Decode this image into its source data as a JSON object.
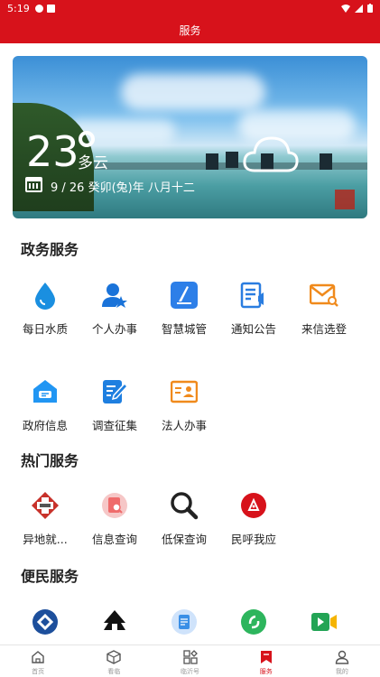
{
  "status": {
    "time": "5:19"
  },
  "header": {
    "title": "服务"
  },
  "weather": {
    "temperature": "23",
    "condition": "多云",
    "date": "9 / 26  癸卯(兔)年 八月十二"
  },
  "sections": {
    "gov": {
      "title": "政务服务",
      "items": [
        {
          "label": "每日水质",
          "icon": "water-drop-icon",
          "color": "#1a8fe0"
        },
        {
          "label": "个人办事",
          "icon": "person-star-icon",
          "color": "#1a73d9"
        },
        {
          "label": "智慧城管",
          "icon": "smart-city-icon",
          "color": "#2d7fe8"
        },
        {
          "label": "通知公告",
          "icon": "notice-icon",
          "color": "#2a7de0"
        },
        {
          "label": "来信选登",
          "icon": "mail-search-icon",
          "color": "#f08a1c"
        },
        {
          "label": "政府信息",
          "icon": "gov-info-icon",
          "color": "#2196f3"
        },
        {
          "label": "调查征集",
          "icon": "survey-edit-icon",
          "color": "#1e7fe0"
        },
        {
          "label": "法人办事",
          "icon": "id-card-icon",
          "color": "#f08a1c"
        }
      ]
    },
    "hot": {
      "title": "热门服务",
      "items": [
        {
          "label": "异地就...",
          "icon": "medical-cross-icon",
          "color": "#c8322b"
        },
        {
          "label": "信息查询",
          "icon": "info-query-icon",
          "color": "#ef6b6b"
        },
        {
          "label": "低保查询",
          "icon": "magnifier-icon",
          "color": "#222222"
        },
        {
          "label": "民呼我应",
          "icon": "citizen-call-icon",
          "color": "#d7121b"
        }
      ]
    },
    "people": {
      "title": "便民服务",
      "items": [
        {
          "label": "",
          "icon": "bank-logo-icon",
          "color": "#1d4f9c"
        },
        {
          "label": "",
          "icon": "house-tree-icon",
          "color": "#111111"
        },
        {
          "label": "",
          "icon": "document-icon",
          "color": "#3a8fe6"
        },
        {
          "label": "",
          "icon": "green-circle-icon",
          "color": "#2db55d"
        },
        {
          "label": "",
          "icon": "video-play-icon",
          "color": "#23a455"
        }
      ]
    }
  },
  "tabs": [
    {
      "label": "首页",
      "icon": "home-icon",
      "active": false
    },
    {
      "label": "看临",
      "icon": "cube-icon",
      "active": false
    },
    {
      "label": "临沂号",
      "icon": "apps-grid-icon",
      "active": false
    },
    {
      "label": "服务",
      "icon": "bookmark-icon",
      "active": true
    },
    {
      "label": "我的",
      "icon": "user-icon",
      "active": false
    }
  ],
  "colors": {
    "brand": "#d7121b"
  }
}
